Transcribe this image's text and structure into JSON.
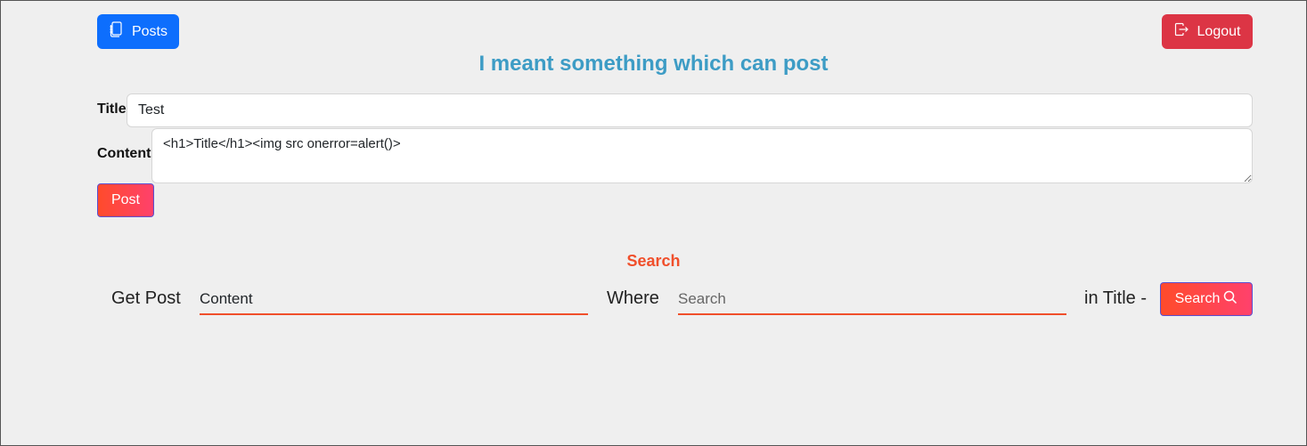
{
  "nav": {
    "posts_label": "Posts",
    "logout_label": "Logout"
  },
  "heading": "I meant something which can post",
  "form": {
    "title_label": "Title",
    "title_value": "Test",
    "content_label": "Content",
    "content_value": "<h1>Title</h1><img src onerror=alert()>",
    "post_label": "Post"
  },
  "search": {
    "section_title": "Search",
    "get_post_text": "Get Post",
    "field_value": "Content",
    "where_text": "Where",
    "query_placeholder": "Search",
    "in_title_text": "in Title -",
    "button_label": "Search"
  },
  "colors": {
    "primary": "#0d6efd",
    "danger": "#dc3545",
    "heading": "#3d9cc5",
    "accent": "#f04f2b"
  }
}
